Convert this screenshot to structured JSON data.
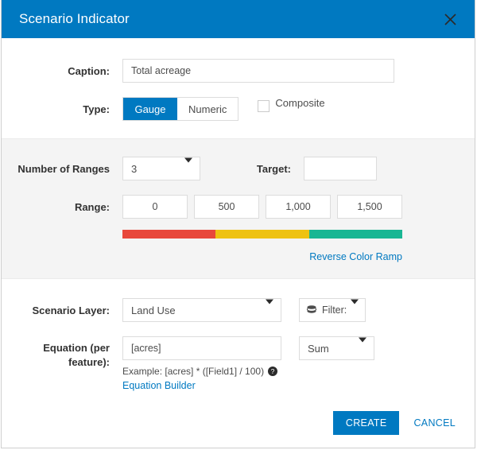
{
  "dialog": {
    "title": "Scenario Indicator",
    "close_icon": "close-icon",
    "header_color": "#0079c1"
  },
  "caption": {
    "label": "Caption:",
    "value": "Total acreage",
    "placeholder": ""
  },
  "type": {
    "label": "Type:",
    "options": [
      "Gauge",
      "Numeric"
    ],
    "selected": "Gauge",
    "composite_label": "Composite",
    "composite_checked": false
  },
  "ranges": {
    "count_label": "Number of Ranges",
    "count_value": "3",
    "target_label": "Target:",
    "target_value": "",
    "target_placeholder": "",
    "range_label": "Range:",
    "range_values": [
      "0",
      "500",
      "1,000",
      "1,500"
    ],
    "ramp_colors": [
      "#e8483c",
      "#eec212",
      "#19b693"
    ],
    "reverse_link": "Reverse Color Ramp"
  },
  "scenario_layer": {
    "label": "Scenario Layer:",
    "value": "Land Use",
    "filter_label": "Filter:",
    "filter_icon": "layers-icon",
    "caret_icon": "chevron-down-icon"
  },
  "equation": {
    "label_line1": "Equation (per",
    "label_line2": "feature):",
    "value": "[acres]",
    "example": "Example: [acres] * ([Field1] / 100)",
    "help_icon": "help-circle-icon",
    "builder_link": "Equation Builder",
    "aggregation_value": "Sum"
  },
  "footer": {
    "create_label": "CREATE",
    "cancel_label": "CANCEL"
  }
}
